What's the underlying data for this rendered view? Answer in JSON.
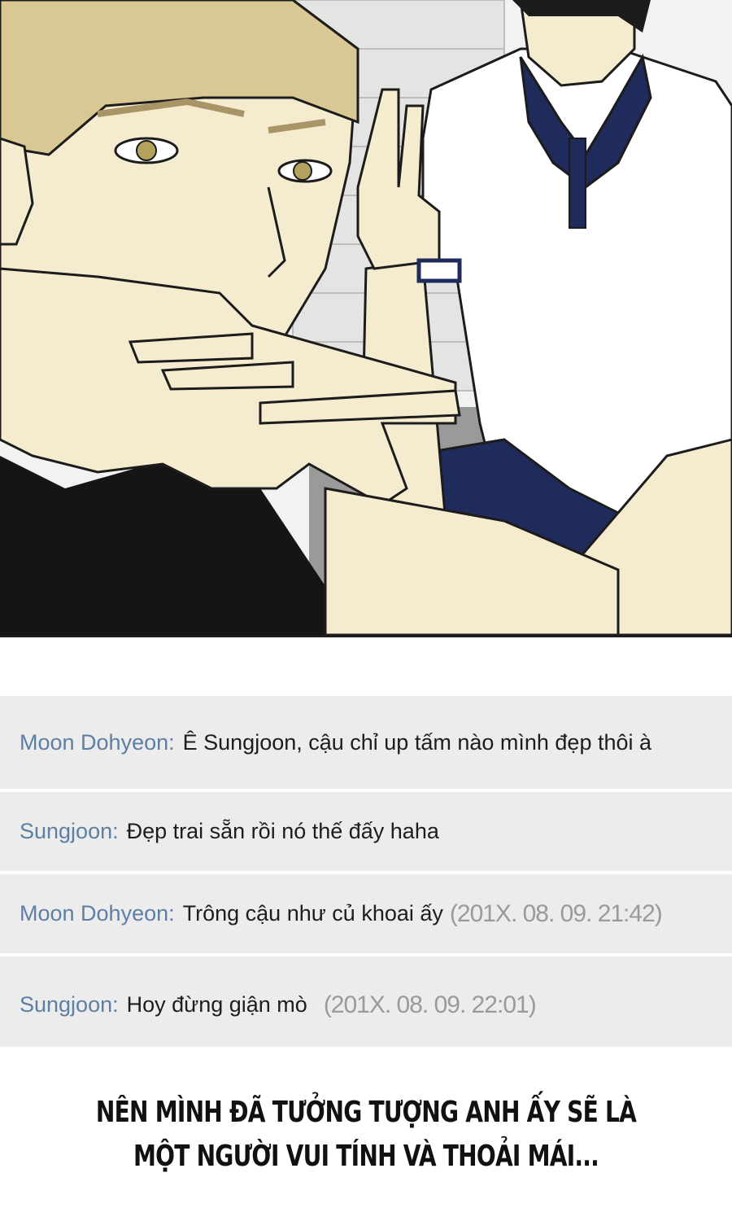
{
  "comments": [
    {
      "name": "Moon Dohyeon:",
      "text": "Ê Sungjoon, cậu chỉ up tấm nào mình đẹp thôi à",
      "time": ""
    },
    {
      "name": "Sungjoon:",
      "text": "Đẹp trai sẵn rồi nó thế đấy haha",
      "time": ""
    },
    {
      "name": "Moon Dohyeon:",
      "text": "Trông cậu như củ khoai ấy",
      "time": "(201X. 08. 09. 21:42)"
    },
    {
      "name": "Sungjoon:",
      "text": "Hoy đừng giận mò",
      "time": "(201X. 08. 09. 22:01)"
    }
  ],
  "caption": {
    "line1": "NÊN MÌNH ĐÃ TƯỞNG TƯỢNG ANH ẤY SẼ LÀ",
    "line2": "MỘT NGƯỜI VUI TÍNH VÀ THOẢI MÁI..."
  },
  "colors": {
    "comment_name": "#5d7fa3",
    "comment_text": "#1d1d1d",
    "timestamp": "#9a9a9a",
    "comment_bg": "#ececec",
    "skin": "#f5ecd0",
    "navy": "#1f2b5a"
  }
}
